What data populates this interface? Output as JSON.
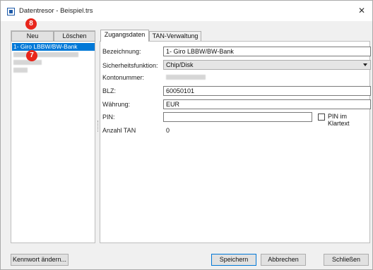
{
  "window": {
    "title": "Datentresor - Beispiel.trs",
    "close_glyph": "✕"
  },
  "badges": [
    "8",
    "7"
  ],
  "left": {
    "new_label": "Neu",
    "delete_label": "Löschen",
    "selected_item": "1- Giro LBBW/BW-Bank"
  },
  "tabs": [
    {
      "label": "Zugangsdaten"
    },
    {
      "label": "TAN-Verwaltung"
    }
  ],
  "form": {
    "bezeichnung_label": "Bezeichnung:",
    "bezeichnung_value": "1- Giro LBBW/BW-Bank",
    "sicherheit_label": "Sicherheitsfunktion:",
    "sicherheit_value": "Chip/Disk",
    "konto_label": "Kontonummer:",
    "blz_label": "BLZ:",
    "blz_value": "60050101",
    "waehrung_label": "Währung:",
    "waehrung_value": "EUR",
    "pin_label": "PIN:",
    "pin_value": "",
    "pin_klartext_label": "PIN im Klartext",
    "anzahl_tan_label": "Anzahl TAN",
    "anzahl_tan_value": "0"
  },
  "buttons": {
    "password": "Kennwort ändern...",
    "save": "Speichern",
    "cancel": "Abbrechen",
    "close": "Schließen"
  }
}
